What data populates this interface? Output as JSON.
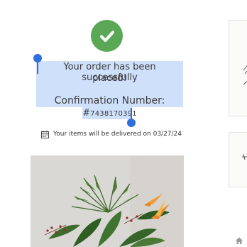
{
  "confirmation": {
    "message_line1": "Your order has been successfully",
    "message_line2": "placed!",
    "number_label": "Confirmation Number:",
    "number_hash": "#",
    "number_value": "7438170391"
  },
  "delivery": {
    "icon": "calendar-icon",
    "text": "Your items will be delivered on 03/27/24"
  },
  "colors": {
    "success": "#5aa856",
    "selection": "#cfe0fb",
    "handle": "#2f6fdc"
  },
  "icons": {
    "success": "checkmark-circle-icon",
    "home": "home-icon"
  }
}
